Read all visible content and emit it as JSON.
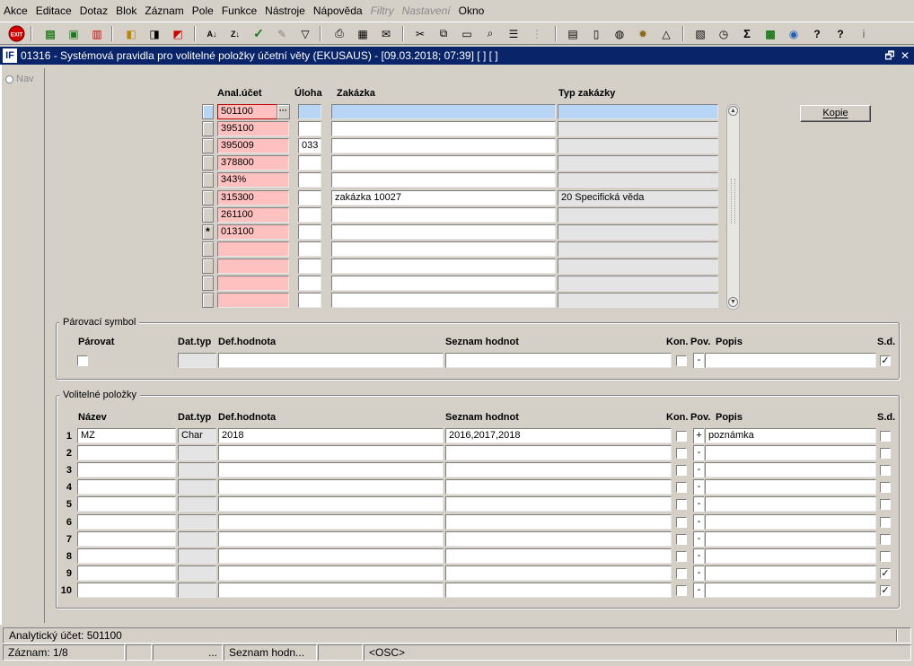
{
  "menu": [
    "Akce",
    "Editace",
    "Dotaz",
    "Blok",
    "Záznam",
    "Pole",
    "Funkce",
    "Nástroje",
    "Nápověda",
    "Filtry",
    "Nastavení",
    "Okno"
  ],
  "menu_disabled": [
    "Filtry",
    "Nastavení"
  ],
  "toolbar": {
    "exit_label": "EXIT"
  },
  "window": {
    "icon_label": "IF",
    "title": "01316 - Systémová pravidla pro volitelné položky účetní věty (EKUSAUS) - [09.03.2018; 07:39]  [ ] [ ]",
    "restore_glyph": "🗗",
    "close_glyph": "✕"
  },
  "nav": {
    "label": "Nav"
  },
  "grid": {
    "headers": {
      "anal": "Anal.účet",
      "uloha": "Úloha",
      "zakazka": "Zakázka",
      "typ": "Typ zakázky"
    },
    "rows": [
      {
        "anal": "501100",
        "uloha": "",
        "zakazka": "",
        "typ": "",
        "marker": ""
      },
      {
        "anal": "395100",
        "uloha": "",
        "zakazka": "",
        "typ": "",
        "marker": ""
      },
      {
        "anal": "395009",
        "uloha": "033",
        "zakazka": "",
        "typ": "",
        "marker": ""
      },
      {
        "anal": "378800",
        "uloha": "",
        "zakazka": "",
        "typ": "",
        "marker": ""
      },
      {
        "anal": "343%",
        "uloha": "",
        "zakazka": "",
        "typ": "",
        "marker": ""
      },
      {
        "anal": "315300",
        "uloha": "",
        "zakazka": "zakázka 10027",
        "typ": "20 Specifická věda",
        "marker": ""
      },
      {
        "anal": "261100",
        "uloha": "",
        "zakazka": "",
        "typ": "",
        "marker": ""
      },
      {
        "anal": "013100",
        "uloha": "",
        "zakazka": "",
        "typ": "",
        "marker": "*"
      },
      {
        "anal": "",
        "uloha": "",
        "zakazka": "",
        "typ": "",
        "marker": ""
      },
      {
        "anal": "",
        "uloha": "",
        "zakazka": "",
        "typ": "",
        "marker": ""
      },
      {
        "anal": "",
        "uloha": "",
        "zakazka": "",
        "typ": "",
        "marker": ""
      },
      {
        "anal": "",
        "uloha": "",
        "zakazka": "",
        "typ": "",
        "marker": ""
      }
    ],
    "lov_glyph": "···"
  },
  "kopie_button": "Kopie",
  "parovaci": {
    "title": "Párovací symbol",
    "headers": {
      "parovat": "Párovat",
      "dattyp": "Dat.typ",
      "defhod": "Def.hodnota",
      "seznam": "Seznam hodnot",
      "kon": "Kon.",
      "pov": "Pov.",
      "popis": "Popis",
      "sd": "S.d."
    },
    "row": {
      "dattyp": "",
      "defhod": "",
      "seznam": "",
      "pov": "-",
      "popis": "",
      "sd": "✓"
    }
  },
  "volitelne": {
    "title": "Volitelné položky",
    "headers": {
      "nazev": "Název",
      "dattyp": "Dat.typ",
      "defhod": "Def.hodnota",
      "seznam": "Seznam hodnot",
      "kon": "Kon.",
      "pov": "Pov.",
      "popis": "Popis",
      "sd": "S.d."
    },
    "rows": [
      {
        "num": "1",
        "nazev": "MZ",
        "dattyp": "Char",
        "defhod": "2018",
        "seznam": "2016,2017,2018",
        "kon": "",
        "pov": "+",
        "popis": "poznámka",
        "sd": ""
      },
      {
        "num": "2",
        "nazev": "",
        "dattyp": "",
        "defhod": "",
        "seznam": "",
        "kon": "",
        "pov": "-",
        "popis": "",
        "sd": ""
      },
      {
        "num": "3",
        "nazev": "",
        "dattyp": "",
        "defhod": "",
        "seznam": "",
        "kon": "",
        "pov": "-",
        "popis": "",
        "sd": ""
      },
      {
        "num": "4",
        "nazev": "",
        "dattyp": "",
        "defhod": "",
        "seznam": "",
        "kon": "",
        "pov": "-",
        "popis": "",
        "sd": ""
      },
      {
        "num": "5",
        "nazev": "",
        "dattyp": "",
        "defhod": "",
        "seznam": "",
        "kon": "",
        "pov": "-",
        "popis": "",
        "sd": ""
      },
      {
        "num": "6",
        "nazev": "",
        "dattyp": "",
        "defhod": "",
        "seznam": "",
        "kon": "",
        "pov": "-",
        "popis": "",
        "sd": ""
      },
      {
        "num": "7",
        "nazev": "",
        "dattyp": "",
        "defhod": "",
        "seznam": "",
        "kon": "",
        "pov": "-",
        "popis": "",
        "sd": ""
      },
      {
        "num": "8",
        "nazev": "",
        "dattyp": "",
        "defhod": "",
        "seznam": "",
        "kon": "",
        "pov": "-",
        "popis": "",
        "sd": ""
      },
      {
        "num": "9",
        "nazev": "",
        "dattyp": "",
        "defhod": "",
        "seznam": "",
        "kon": "",
        "pov": "-",
        "popis": "",
        "sd": "✓"
      },
      {
        "num": "10",
        "nazev": "",
        "dattyp": "",
        "defhod": "",
        "seznam": "",
        "kon": "",
        "pov": "-",
        "popis": "",
        "sd": "✓"
      }
    ]
  },
  "status": {
    "line1": "Analytický účet: 501100",
    "record": "Záznam: 1/8",
    "ellipsis": "...",
    "list": "Seznam hodn...",
    "osc": "<OSC>"
  },
  "colors": {
    "title_bar": "#0a246a",
    "mandatory_pink": "#ffc0c0",
    "current_row_blue": "#b9d5f5",
    "disabled_grey": "#e4e4e4"
  }
}
